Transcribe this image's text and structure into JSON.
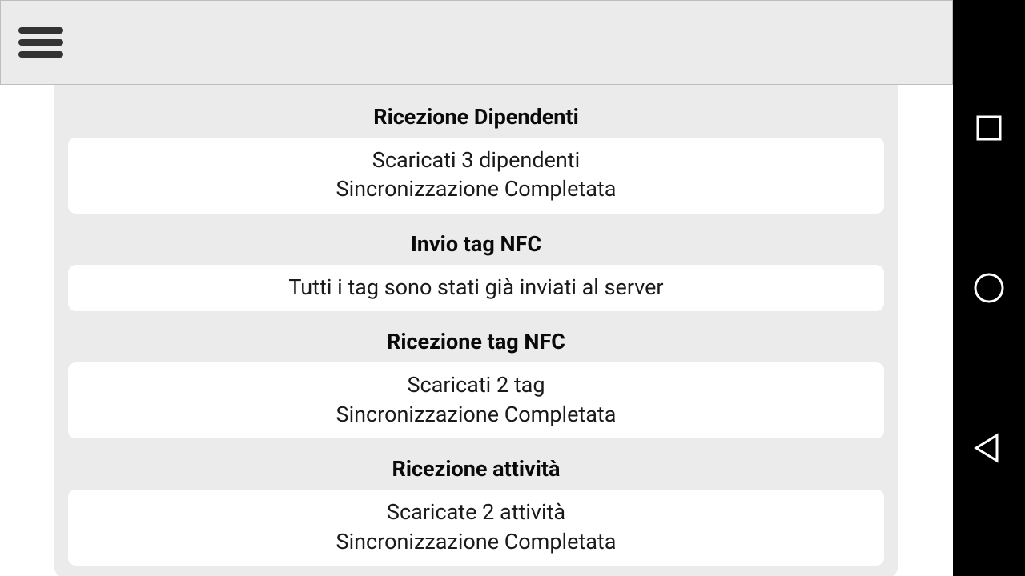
{
  "sections": [
    {
      "title": "Ricezione Dipendenti",
      "lines": [
        "Scaricati 3 dipendenti",
        "Sincronizzazione Completata"
      ]
    },
    {
      "title": "Invio tag NFC",
      "lines": [
        "Tutti i tag sono stati già inviati al server"
      ]
    },
    {
      "title": "Ricezione tag NFC",
      "lines": [
        "Scaricati 2 tag",
        "Sincronizzazione Completata"
      ]
    },
    {
      "title": "Ricezione attività",
      "lines": [
        "Scaricate 2 attività",
        "Sincronizzazione Completata"
      ]
    }
  ],
  "nav": {
    "recent": "recent-apps",
    "home": "home",
    "back": "back"
  }
}
